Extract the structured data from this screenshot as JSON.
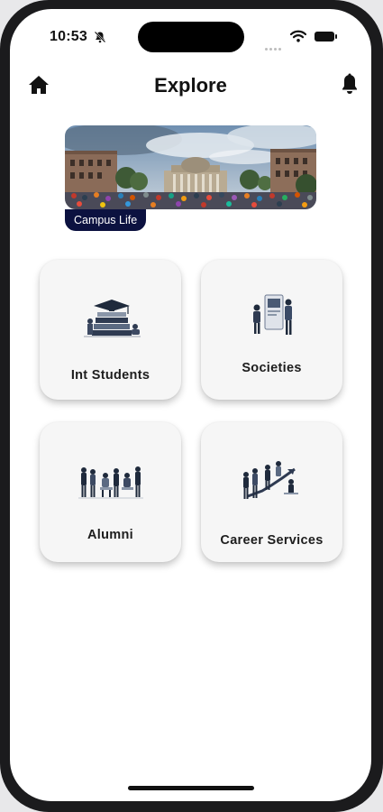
{
  "status_bar": {
    "time": "10:53"
  },
  "header": {
    "title": "Explore"
  },
  "banner": {
    "label": "Campus Life"
  },
  "cards": [
    {
      "label": "Int Students"
    },
    {
      "label": "Societies"
    },
    {
      "label": "Alumni"
    },
    {
      "label": "Career Services"
    }
  ],
  "colors": {
    "banner_label_bg": "#0c1240",
    "card_bg": "#f6f6f6",
    "screen_bg": "#ffffff"
  },
  "icons": {
    "home": "home-icon",
    "notifications": "bell-icon",
    "silent": "bell-slash-icon"
  }
}
